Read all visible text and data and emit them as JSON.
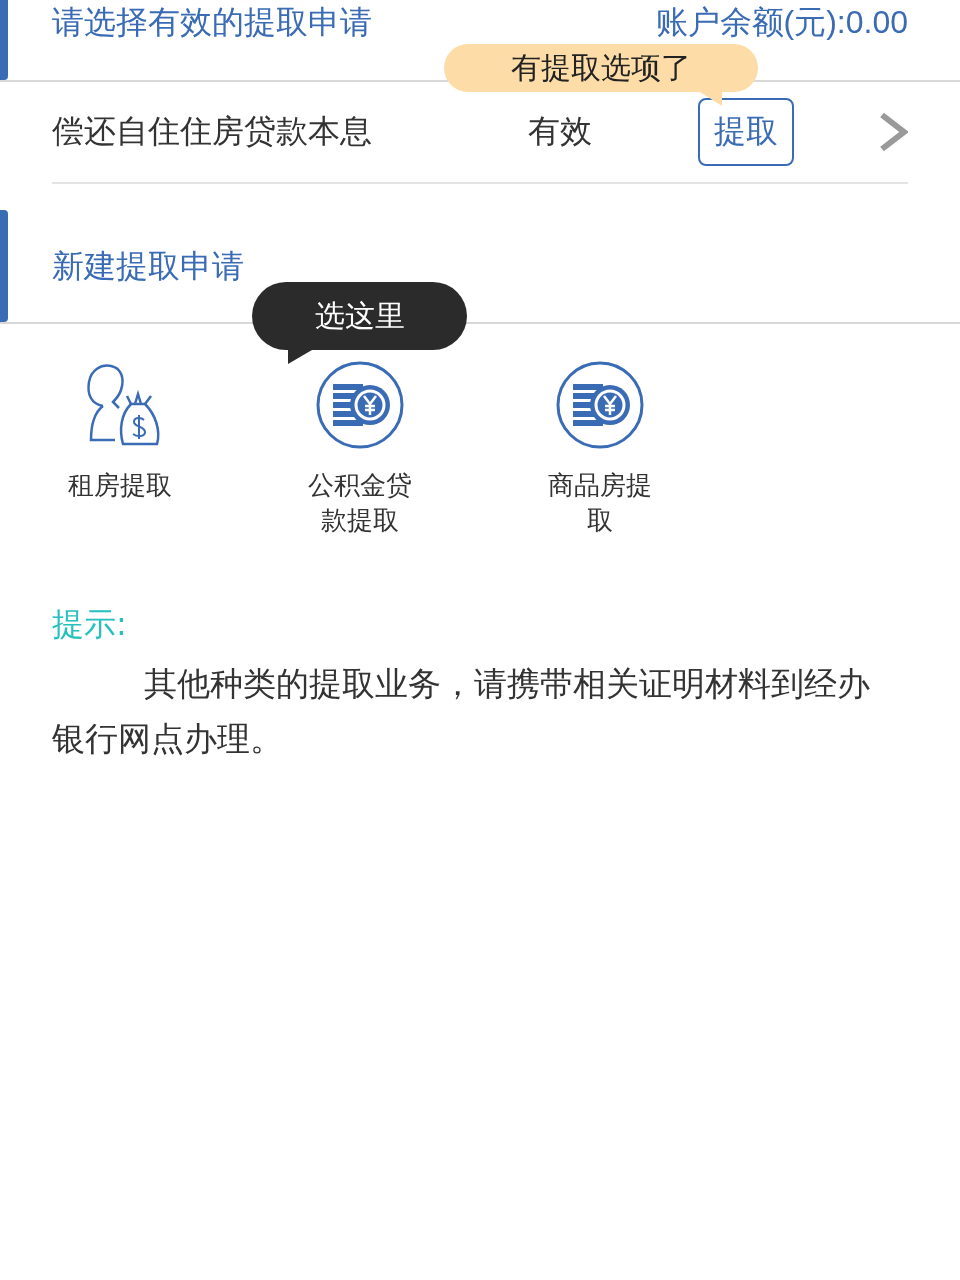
{
  "existing": {
    "title": "请选择有效的提取申请",
    "balance": "账户余额(元):0.00",
    "tooltip": "有提取选项了",
    "rows": [
      {
        "name": "偿还自住住房贷款本息",
        "status": "有效",
        "action": "提取"
      }
    ]
  },
  "new_application": {
    "title": "新建提取申请",
    "tooltip": "选这里",
    "options": [
      {
        "kind": "person",
        "label": "租房提取"
      },
      {
        "kind": "coins",
        "label": "公积金贷款提取"
      },
      {
        "kind": "coins",
        "label": "商品房提取"
      }
    ]
  },
  "tip": {
    "heading": "提示:",
    "text": "其他种类的提取业务，请携带相关证明材料到经办银行网点办理。"
  }
}
